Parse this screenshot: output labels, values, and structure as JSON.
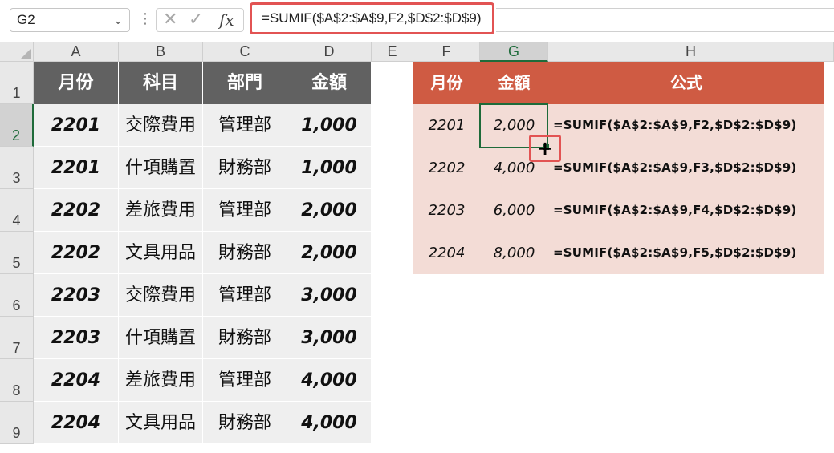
{
  "formula_bar": {
    "name_box": "G2",
    "cancel_glyph": "✕",
    "enter_glyph": "✓",
    "fx_label": "fx",
    "formula": "=SUMIF($A$2:$A$9,F2,$D$2:$D$9)"
  },
  "columns": [
    "A",
    "B",
    "C",
    "D",
    "E",
    "F",
    "G",
    "H"
  ],
  "rows": [
    "1",
    "2",
    "3",
    "4",
    "5",
    "6",
    "7",
    "8",
    "9"
  ],
  "selected_column": "G",
  "selected_row": "2",
  "left_table": {
    "headers": [
      "月份",
      "科目",
      "部門",
      "金額"
    ],
    "rows": [
      [
        "2201",
        "交際費用",
        "管理部",
        "1,000"
      ],
      [
        "2201",
        "什項購置",
        "財務部",
        "1,000"
      ],
      [
        "2202",
        "差旅費用",
        "管理部",
        "2,000"
      ],
      [
        "2202",
        "文具用品",
        "財務部",
        "2,000"
      ],
      [
        "2203",
        "交際費用",
        "管理部",
        "3,000"
      ],
      [
        "2203",
        "什項購置",
        "財務部",
        "3,000"
      ],
      [
        "2204",
        "差旅費用",
        "管理部",
        "4,000"
      ],
      [
        "2204",
        "文具用品",
        "財務部",
        "4,000"
      ]
    ]
  },
  "right_table": {
    "headers": [
      "月份",
      "金額",
      "公式"
    ],
    "rows": [
      [
        "2201",
        "2,000",
        "=SUMIF($A$2:$A$9,F2,$D$2:$D$9)"
      ],
      [
        "2202",
        "4,000",
        "=SUMIF($A$2:$A$9,F3,$D$2:$D$9)"
      ],
      [
        "2203",
        "6,000",
        "=SUMIF($A$2:$A$9,F4,$D$2:$D$9)"
      ],
      [
        "2204",
        "8,000",
        "=SUMIF($A$2:$A$9,F5,$D$2:$D$9)"
      ]
    ]
  },
  "cursor": {
    "glyph": "+",
    "icon": "fill-cross-cursor"
  },
  "colors": {
    "left_header": "#616161",
    "right_header": "#cf5b43",
    "right_body": "#f3dcd6",
    "highlight": "#e25353",
    "selection": "#1e6b3a"
  }
}
